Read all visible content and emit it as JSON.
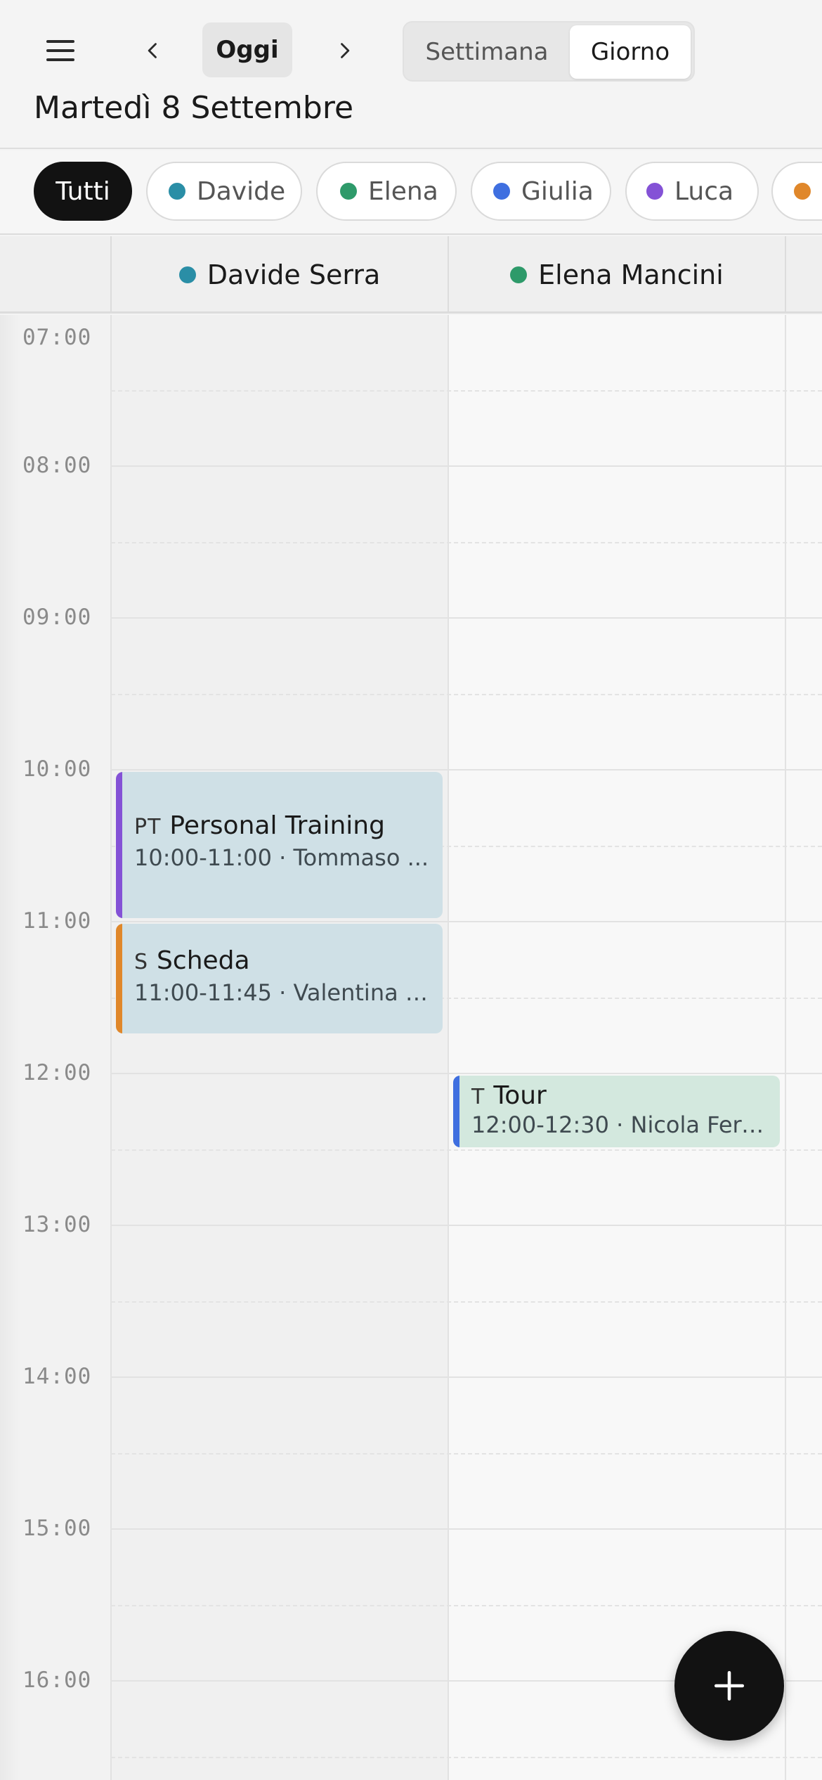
{
  "header": {
    "today_label": "Oggi",
    "view_week_label": "Settimana",
    "view_day_label": "Giorno",
    "date_title": "Martedì 8 Settembre"
  },
  "filters": [
    {
      "label": "Tutti",
      "active": true
    },
    {
      "label": "Davide",
      "color": "#2a8ea6"
    },
    {
      "label": "Elena",
      "color": "#2e9a6a"
    },
    {
      "label": "Giulia",
      "color": "#3f6fe0"
    },
    {
      "label": "Luca",
      "color": "#8452d6"
    },
    {
      "label": "",
      "color": "#e0872a"
    }
  ],
  "columns": [
    {
      "name": "Davide Serra",
      "color": "#2a8ea6"
    },
    {
      "name": "Elena Mancini",
      "color": "#2e9a6a"
    }
  ],
  "hours": [
    "07:00",
    "08:00",
    "09:00",
    "10:00",
    "11:00",
    "12:00",
    "13:00",
    "14:00",
    "15:00",
    "16:00"
  ],
  "events": [
    {
      "abbr": "PT",
      "title": "Personal Training",
      "subtitle": "10:00-11:00 · Tommaso ...",
      "bar_color": "#8452d6",
      "bg_color": "#cfe0e6"
    },
    {
      "abbr": "S",
      "title": "Scheda",
      "subtitle": "11:00-11:45 · Valentina C...",
      "bar_color": "#e0872a",
      "bg_color": "#cfe0e6"
    },
    {
      "abbr": "T",
      "title": "Tour",
      "subtitle": "12:00-12:30 · Nicola Ferr...",
      "bar_color": "#3f6fe0",
      "bg_color": "#d3e8de"
    }
  ]
}
